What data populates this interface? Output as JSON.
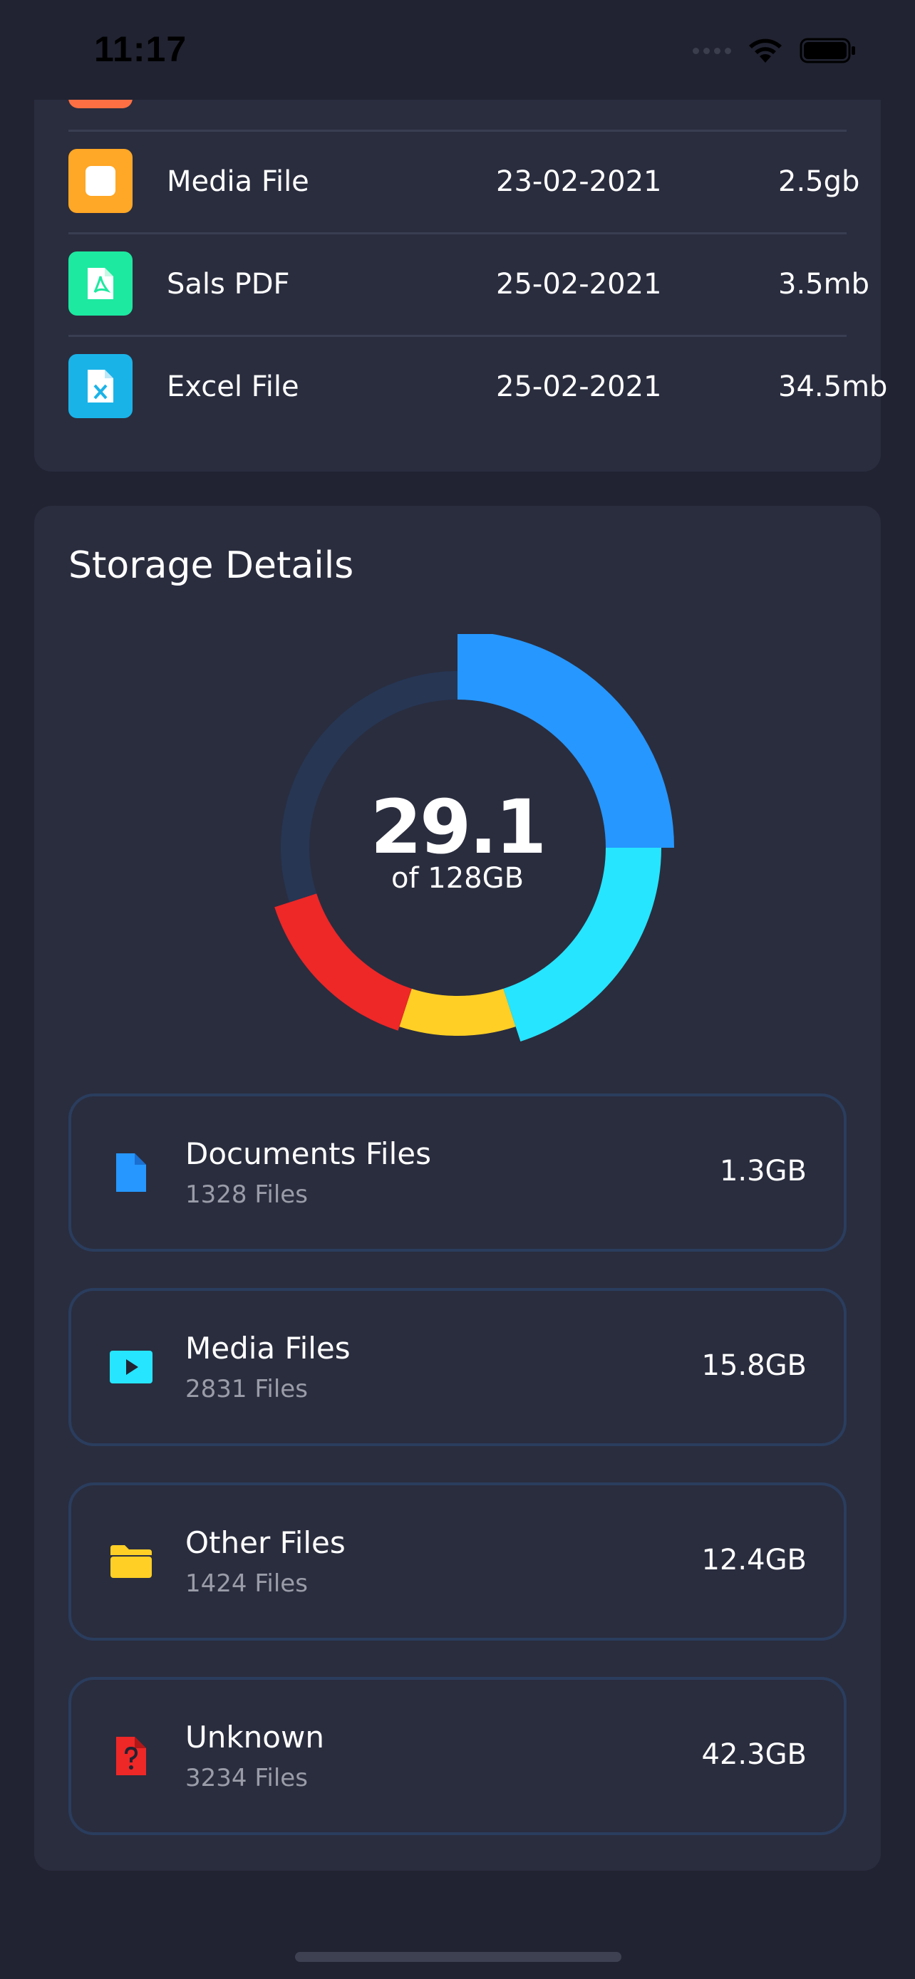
{
  "status_bar": {
    "time": "11:17"
  },
  "recent_files": [
    {
      "name": "Media File",
      "date": "23-02-2021",
      "size": "2.5gb",
      "icon": "media-file-icon",
      "color": "#ffa726"
    },
    {
      "name": "Sals PDF",
      "date": "25-02-2021",
      "size": "3.5mb",
      "icon": "pdf-file-icon",
      "color": "#1de9a0"
    },
    {
      "name": "Excel File",
      "date": "25-02-2021",
      "size": "34.5mb",
      "icon": "excel-file-icon",
      "color": "#1ab3e8"
    }
  ],
  "storage": {
    "title": "Storage Details",
    "used_value": "29.1",
    "total_label": "of 128GB",
    "items": [
      {
        "name": "Documents Files",
        "count": "1328 Files",
        "size": "1.3GB",
        "icon": "document-icon",
        "color": "#2697ff"
      },
      {
        "name": "Media Files",
        "count": "2831 Files",
        "size": "15.8GB",
        "icon": "media-play-icon",
        "color": "#26e5ff"
      },
      {
        "name": "Other Files",
        "count": "1424 Files",
        "size": "12.4GB",
        "icon": "folder-icon",
        "color": "#ffcf26"
      },
      {
        "name": "Unknown",
        "count": "3234 Files",
        "size": "42.3GB",
        "icon": "unknown-file-icon",
        "color": "#ee2727"
      }
    ]
  },
  "chart_data": {
    "type": "pie",
    "style": "donut",
    "series": [
      {
        "name": "Documents Files",
        "share": 0.25,
        "color": "#2697ff"
      },
      {
        "name": "Media Files",
        "share": 0.2,
        "color": "#26e5ff"
      },
      {
        "name": "Other Files",
        "share": 0.1,
        "color": "#ffcf26"
      },
      {
        "name": "Unknown",
        "share": 0.15,
        "color": "#ee2727"
      },
      {
        "name": "",
        "share": 0.3,
        "color": "#263653"
      }
    ],
    "center_value": "29.1",
    "center_label": "of 128GB"
  }
}
